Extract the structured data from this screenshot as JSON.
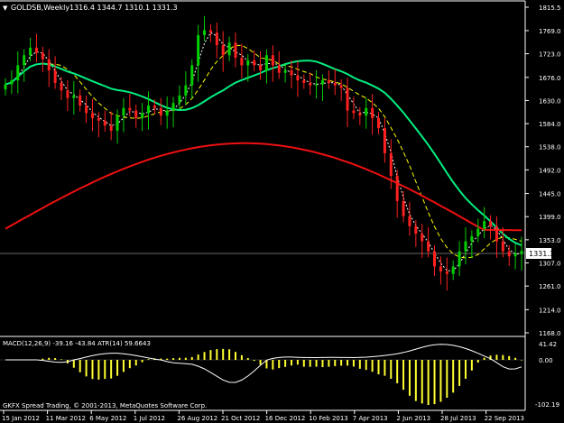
{
  "main": {
    "header": {
      "symbol_line": "GOLDSB,Weekly",
      "ohlc": "1316.4 1344.7 1310.1 1331.3"
    },
    "price_axis": {
      "ticks": [
        "1815.5",
        "1769.0",
        "1723.0",
        "1676.0",
        "1630.0",
        "1584.0",
        "1538.0",
        "1492.0",
        "1445.0",
        "1399.0",
        "1353.0",
        "1307.0",
        "1261.0",
        "1214.0",
        "1168.0"
      ],
      "current_price": "1331.3"
    }
  },
  "indicator": {
    "header": "MACD(12,26,9) -39.16 -43.84  ATR(14) 59.6643",
    "ticks": [
      "41.42",
      "0.00",
      "-102.19"
    ],
    "copyright": "GKFX Spread Trading, © 2001-2013, MetaQuotes Software Corp."
  },
  "time_axis": {
    "labels": [
      "15 Jan 2012",
      "11 Mar 2012",
      "6 May 2012",
      "1 Jul 2012",
      "26 Aug 2012",
      "21 Oct 2012",
      "16 Dec 2012",
      "10 Feb 2013",
      "7 Apr 2013",
      "2 Jun 2013",
      "28 Jul 2013",
      "22 Sep 2013"
    ]
  },
  "colors": {
    "background": "#000000",
    "bull_candle": "#00d000",
    "bear_candle": "#ff2020",
    "ma_fast": "#ffff00",
    "ma_ema_short": "#ffffff",
    "ma_green": "#00ee80",
    "ma_red": "#ee1010",
    "ma_cyan": "#20c0f0",
    "macd_hist": "#ffff30",
    "macd_signal": "#ffffff"
  },
  "chart_data": {
    "type": "candlestick",
    "timeframe": "Weekly",
    "y_range": [
      1168.0,
      1815.5
    ],
    "closes": [
      1662,
      1670,
      1700,
      1720,
      1735,
      1725,
      1712,
      1690,
      1665,
      1650,
      1635,
      1640,
      1620,
      1605,
      1595,
      1590,
      1580,
      1570,
      1600,
      1615,
      1610,
      1595,
      1605,
      1620,
      1615,
      1600,
      1610,
      1625,
      1640,
      1660,
      1700,
      1760,
      1770,
      1765,
      1740,
      1720,
      1745,
      1715,
      1700,
      1710,
      1700,
      1690,
      1720,
      1700,
      1685,
      1690,
      1680,
      1670,
      1665,
      1660,
      1662,
      1670,
      1665,
      1660,
      1655,
      1610,
      1605,
      1600,
      1615,
      1595,
      1575,
      1525,
      1480,
      1430,
      1400,
      1380,
      1365,
      1350,
      1330,
      1300,
      1290,
      1285,
      1300,
      1330,
      1350,
      1360,
      1375,
      1390,
      1380,
      1350,
      1330,
      1320,
      1325,
      1331
    ]
  }
}
